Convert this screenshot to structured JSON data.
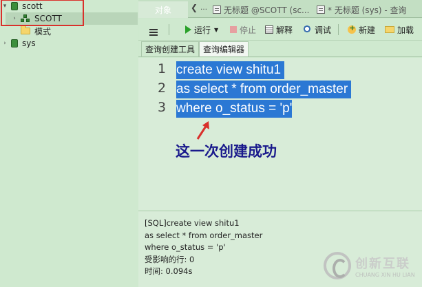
{
  "nav": {
    "items": [
      {
        "label": "scott"
      },
      {
        "label": "SCOTT"
      },
      {
        "label": "模式"
      },
      {
        "label": "sys"
      }
    ]
  },
  "tabs": [
    {
      "label": "对象"
    },
    {
      "label": "无标题 @SCOTT (sc..."
    },
    {
      "label": "* 无标题 (sys) - 查询"
    }
  ],
  "toolbar": {
    "run_label": "运行",
    "stop_label": "停止",
    "explain_label": "解释",
    "debug_label": "调试",
    "new_label": "新建",
    "load_label": "加载"
  },
  "subtabs": [
    {
      "label": "查询创建工具"
    },
    {
      "label": "查询编辑器"
    }
  ],
  "editor": {
    "lines": [
      {
        "no": "1",
        "code": "create view shitu1 "
      },
      {
        "no": "2",
        "code": "as select * from order_master "
      },
      {
        "no": "3",
        "code": "where o_status = 'p'"
      }
    ],
    "annotation": "这一次创建成功"
  },
  "result": {
    "lines": [
      "[SQL]create view shitu1",
      "as select * from order_master",
      "where o_status = 'p'",
      "受影响的行: 0",
      "时间: 0.094s"
    ]
  },
  "watermark": {
    "cn": "创新互联",
    "en": "CHUANG XIN HU LIAN"
  },
  "colors": {
    "background": "#cde8cd",
    "selection": "#2b78d4",
    "annotation": "#1a1a8c",
    "highlight_box": "#d9302b"
  }
}
